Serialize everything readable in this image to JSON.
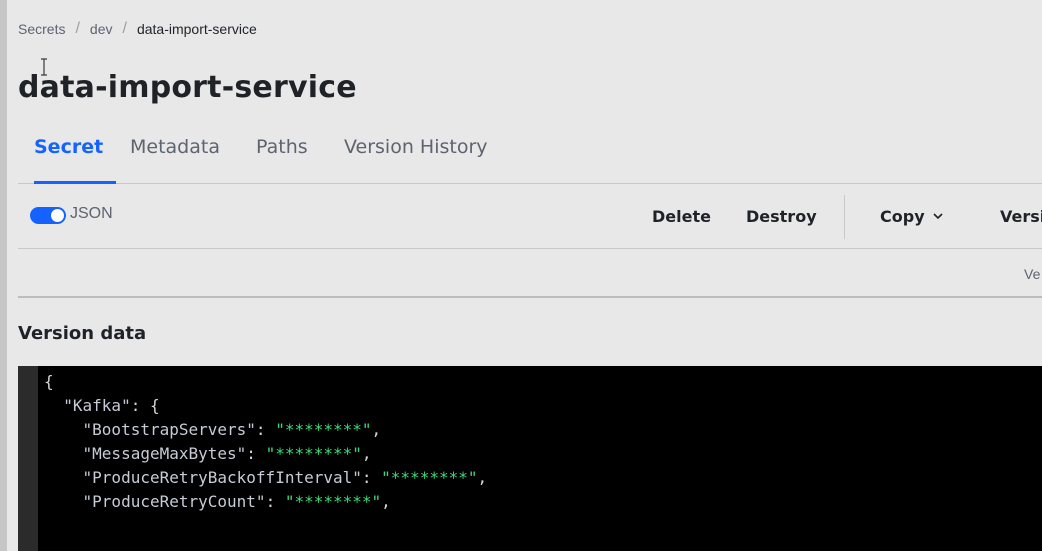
{
  "breadcrumb": {
    "items": [
      "Secrets",
      "dev",
      "data-import-service"
    ],
    "separator": "/"
  },
  "page": {
    "title": "data-import-service"
  },
  "tabs": [
    {
      "label": "Secret",
      "active": true
    },
    {
      "label": "Metadata",
      "active": false
    },
    {
      "label": "Paths",
      "active": false
    },
    {
      "label": "Version History",
      "active": false
    }
  ],
  "toolbar": {
    "json_toggle_label": "JSON",
    "json_toggle_on": true,
    "delete_label": "Delete",
    "destroy_label": "Destroy",
    "copy_label": "Copy",
    "version_label_truncated": "Versi"
  },
  "info_row": {
    "trailing_text_truncated": "Ve"
  },
  "version_data": {
    "title": "Version data",
    "lines": [
      {
        "indent": 0,
        "text": "{"
      },
      {
        "indent": 1,
        "key": "\"Kafka\"",
        "sep": ": ",
        "tail": "{"
      },
      {
        "indent": 2,
        "key": "\"BootstrapServers\"",
        "sep": ": ",
        "value": "\"********\"",
        "tail": ","
      },
      {
        "indent": 2,
        "key": "\"MessageMaxBytes\"",
        "sep": ": ",
        "value": "\"********\"",
        "tail": ","
      },
      {
        "indent": 2,
        "key": "\"ProduceRetryBackoffInterval\"",
        "sep": ": ",
        "value": "\"********\"",
        "tail": ","
      },
      {
        "indent": 2,
        "key": "\"ProduceRetryCount\"",
        "sep": ": ",
        "value": "\"********\"",
        "tail": ","
      }
    ]
  },
  "colors": {
    "accent": "#1563ff",
    "background": "#e8e8e8",
    "code_bg": "#000000",
    "code_string": "#3ddb7a"
  }
}
